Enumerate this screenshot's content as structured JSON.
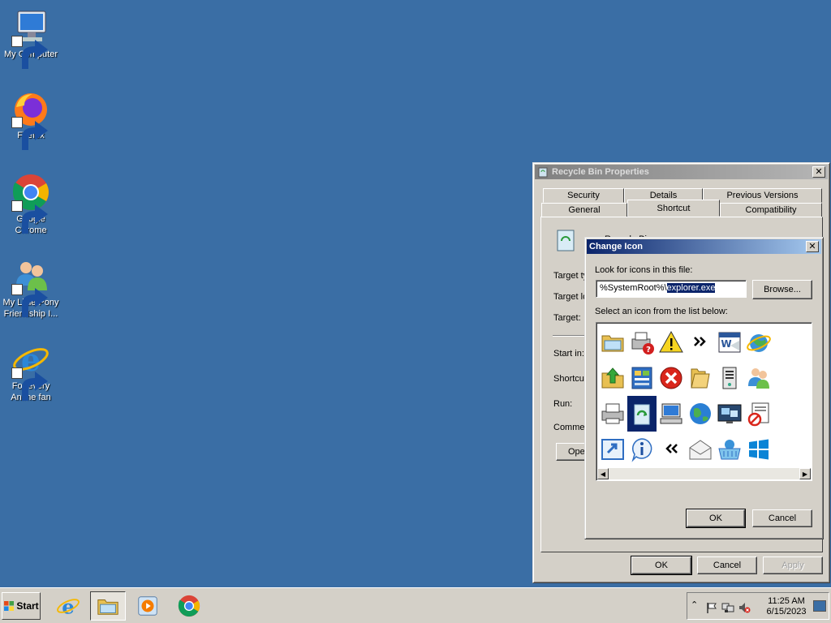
{
  "desktop": {
    "icons": [
      {
        "label": "My Computer",
        "icon": "computer-icon"
      },
      {
        "label": "Firefox",
        "icon": "firefox-icon"
      },
      {
        "label": "Google Chrome",
        "icon": "chrome-icon"
      },
      {
        "label": "My Little Pony Friendship I...",
        "icon": "users-icon"
      },
      {
        "label": "For every Anime fan",
        "icon": "internet-explorer-icon"
      }
    ]
  },
  "properties": {
    "title": "Recycle Bin Properties",
    "tabs_back": [
      "Security",
      "Details",
      "Previous Versions"
    ],
    "tabs_front": [
      "General",
      "Shortcut",
      "Compatibility"
    ],
    "selected_tab": "Shortcut",
    "name_partial": "Recycle Bin",
    "labels": [
      "Target ty",
      "Target lo",
      "Target:",
      "Start in:",
      "Shortcut",
      "Run:",
      "Commer"
    ],
    "open_button_partial": "Ope",
    "ok": "OK",
    "cancel": "Cancel",
    "apply": "Apply"
  },
  "change_icon": {
    "title": "Change Icon",
    "look_label": "Look for icons in this file:",
    "path_prefix": "%SystemRoot%\\",
    "path_selected": "explorer.exe",
    "browse": "Browse...",
    "select_label": "Select an icon from the list below:",
    "ok": "OK",
    "cancel": "Cancel",
    "icons": [
      "folder-window-icon",
      "printer-help-icon",
      "warning-icon",
      "chevron-right-icon",
      "word-document-icon",
      "globe-e-icon",
      "folder-up-arrow-icon",
      "control-panel-icon",
      "error-icon",
      "folder-open-icon",
      "server-icon",
      "users-icon",
      "printer-icon",
      "recycle-bin-icon",
      "computer-icon",
      "earth-icon",
      "display-icon",
      "blocked-document-icon",
      "run-icon",
      "info-icon",
      "chevron-left-icon",
      "envelope-icon",
      "shopping-basket-icon",
      "windows-logo-icon"
    ],
    "selected_index": 13
  },
  "taskbar": {
    "start": "Start",
    "time": "11:25 AM",
    "date": "6/15/2023"
  }
}
